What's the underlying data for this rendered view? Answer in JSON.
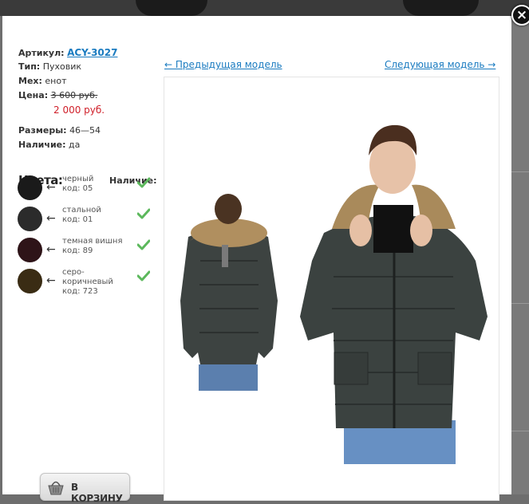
{
  "product": {
    "article_label": "Артикул:",
    "article_value": "ACY-3027",
    "type_label": "Тип:",
    "type_value": "Пуховик",
    "fur_label": "Мех:",
    "fur_value": "енот",
    "price_label": "Цена:",
    "price_old": "3 600 руб.",
    "price_new": "2 000 руб.",
    "sizes_label": "Размеры:",
    "sizes_value": "46—54",
    "availability_label": "Наличие:",
    "availability_value": "да"
  },
  "colors": {
    "title": "Цвета:",
    "stock_header": "Наличие:",
    "arrow": "←",
    "items": [
      {
        "name": "черный",
        "code": "код: 05",
        "hex": "#1a1a1a",
        "in_stock": true
      },
      {
        "name": "стальной",
        "code": "код: 01",
        "hex": "#2b2b2b",
        "in_stock": true
      },
      {
        "name": "темная вишня",
        "code": "код: 89",
        "hex": "#2e1418",
        "in_stock": true
      },
      {
        "name": "серо-коричневый",
        "code": "код: 723",
        "hex": "#3a2c14",
        "in_stock": true
      }
    ]
  },
  "navigation": {
    "prev_label": "← Предыдущая модель",
    "next_label": "Следующая модель →"
  },
  "cart": {
    "button_label": "В КОРЗИНУ"
  },
  "modal": {
    "close_symbol": "×"
  },
  "theme": {
    "link_color": "#1a7bc0",
    "price_new_color": "#d0202a",
    "check_color": "#5cb85c"
  }
}
